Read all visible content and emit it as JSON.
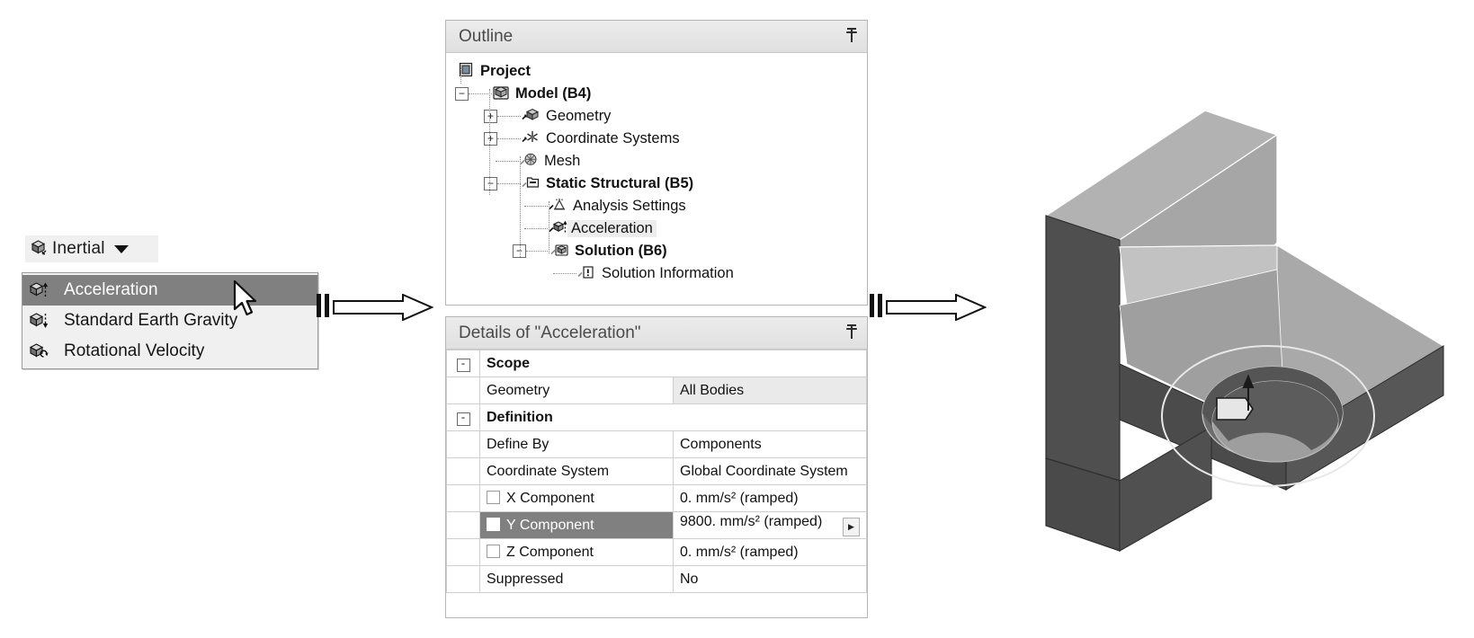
{
  "toolbar": {
    "inertial_label": "Inertial",
    "icon": "inertial-cube-icon",
    "caret": "chevron-down-icon"
  },
  "inertial_menu": {
    "items": [
      {
        "label": "Acceleration",
        "icon": "acceleration-cube-icon",
        "selected": true
      },
      {
        "label": "Standard Earth Gravity",
        "icon": "gravity-cube-icon",
        "selected": false
      },
      {
        "label": "Rotational Velocity",
        "icon": "rotational-velocity-cube-icon",
        "selected": false
      }
    ],
    "cursor": "mouse-pointer-icon"
  },
  "outline_panel": {
    "title": "Outline",
    "pin": "pin-icon",
    "tree": [
      {
        "label": "Project",
        "icon": "project-icon",
        "depth": 0,
        "bold": true,
        "expander": "",
        "highlight": false
      },
      {
        "label": "Model (B4)",
        "icon": "model-icon",
        "depth": 1,
        "bold": true,
        "expander": "-",
        "highlight": false
      },
      {
        "label": "Geometry",
        "icon": "geometry-icon",
        "depth": 2,
        "bold": false,
        "expander": "+",
        "highlight": false
      },
      {
        "label": "Coordinate Systems",
        "icon": "coordinate-systems-icon",
        "depth": 2,
        "bold": false,
        "expander": "+",
        "highlight": false
      },
      {
        "label": "Mesh",
        "icon": "mesh-icon",
        "depth": 2,
        "bold": false,
        "expander": "",
        "highlight": false
      },
      {
        "label": "Static Structural (B5)",
        "icon": "static-structural-icon",
        "depth": 2,
        "bold": true,
        "expander": "-",
        "highlight": false
      },
      {
        "label": "Analysis Settings",
        "icon": "analysis-settings-icon",
        "depth": 3,
        "bold": false,
        "expander": "",
        "highlight": false
      },
      {
        "label": "Acceleration",
        "icon": "acceleration-cube-icon",
        "depth": 3,
        "bold": false,
        "expander": "",
        "highlight": true
      },
      {
        "label": "Solution (B6)",
        "icon": "solution-icon",
        "depth": 3,
        "bold": true,
        "expander": "-",
        "highlight": false
      },
      {
        "label": "Solution Information",
        "icon": "solution-information-icon",
        "depth": 4,
        "bold": false,
        "expander": "",
        "highlight": false
      }
    ]
  },
  "details_panel": {
    "title": "Details of \"Acceleration\"",
    "pin": "pin-icon",
    "rows": [
      {
        "type": "section",
        "sign": "-",
        "label": "Scope"
      },
      {
        "type": "pair",
        "key": "Geometry",
        "value": "All Bodies",
        "shaded": true
      },
      {
        "type": "section",
        "sign": "-",
        "label": "Definition"
      },
      {
        "type": "pair",
        "key": "Define By",
        "value": "Components",
        "shaded": false
      },
      {
        "type": "pair",
        "key": "Coordinate System",
        "value": "Global Coordinate System",
        "shaded": false
      },
      {
        "type": "check",
        "key": "X Component",
        "value": "0. mm/s²  (ramped)",
        "selected": false,
        "arrow": false
      },
      {
        "type": "check",
        "key": "Y Component",
        "value": "9800. mm/s²  (ramped)",
        "selected": true,
        "arrow": true
      },
      {
        "type": "check",
        "key": "Z Component",
        "value": "0. mm/s²  (ramped)",
        "selected": false,
        "arrow": false
      },
      {
        "type": "pair",
        "key": "Suppressed",
        "value": "No",
        "shaded": false
      }
    ]
  },
  "flow": {
    "arrow1": "block-arrow-right-icon",
    "arrow2": "block-arrow-right-icon"
  },
  "model_viewport": {
    "name": "3d-bracket-model",
    "description": "L-shaped bracket with counterbored hole",
    "colors": {
      "face_light": "#a8a8a8",
      "face_mid": "#9a9a9a",
      "face_dark": "#555555",
      "face_darker": "#4a4a4a",
      "edge": "#ffffff",
      "outline": "#2b2b2b"
    }
  }
}
